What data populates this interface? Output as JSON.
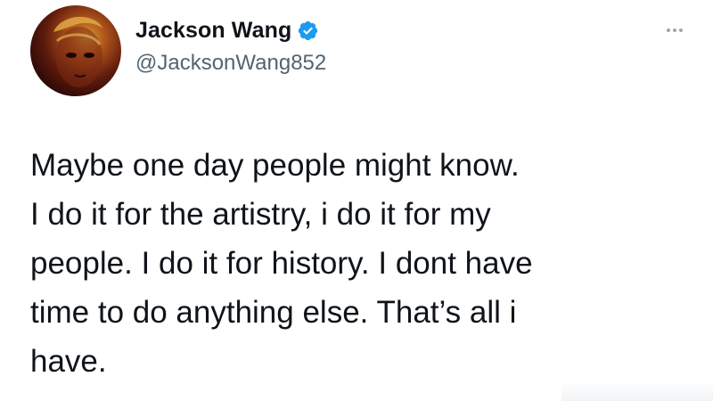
{
  "tweet": {
    "author": {
      "display_name": "Jackson Wang",
      "handle": "@JacksonWang852",
      "verified": true,
      "avatar_icon": "profile-photo"
    },
    "more_icon": "more-options-icon",
    "text": "Maybe one day people might know.\nI do it for the artistry, i do it for my\npeople. I do it for history. I dont have\ntime to do anything else. That’s all i\nhave."
  },
  "colors": {
    "text": "#0f1419",
    "handle": "#536471",
    "verified_badge": "#1d9bf0",
    "background": "#ffffff"
  }
}
